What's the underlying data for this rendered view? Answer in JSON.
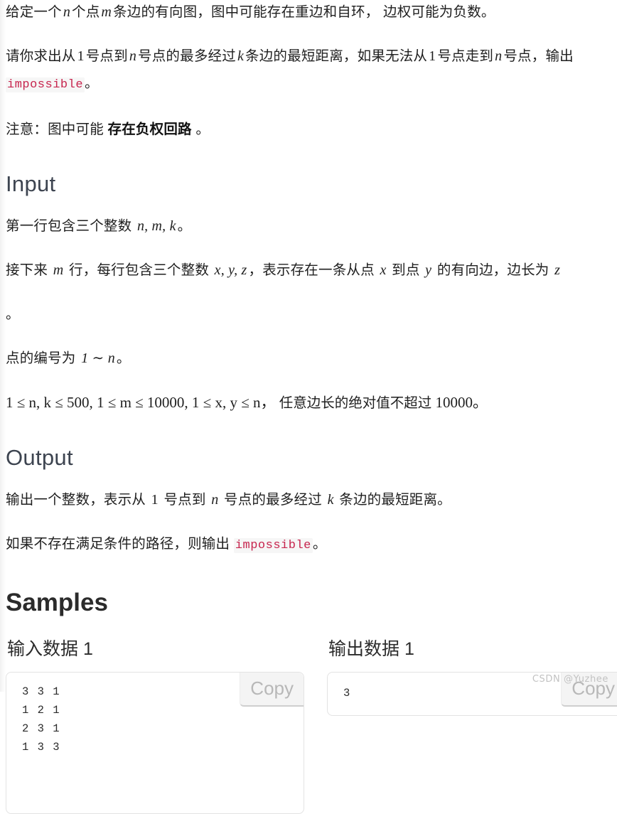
{
  "problem": {
    "p1_pre": "给定一个",
    "p1_n": "n",
    "p1_mid1": "个点",
    "p1_m": "m",
    "p1_mid2": "条边的有向图，图中可能存在重边和自环，  边权可能为负数。",
    "p2_pre": "请你求出从",
    "p2_one": "1",
    "p2_a": "号点到",
    "p2_n": "n",
    "p2_b": "号点的最多经过",
    "p2_k": "k",
    "p2_c": "条边的最短距离，如果无法从",
    "p2_one2": "1",
    "p2_d": "号点走到",
    "p2_n2": "n",
    "p2_e": "号点，输出",
    "p2_code": "impossible",
    "p2_end": "。",
    "p3_pre": "注意：图中可能",
    "p3_bold": "存在负权回路",
    "p3_end": "。"
  },
  "input_section": {
    "heading": "Input",
    "line1_pre": "第一行包含三个整数",
    "line1_vars": "n, m, k",
    "line1_end": "。",
    "line2_pre": "接下来",
    "line2_m": "m",
    "line2_a": "行，每行包含三个整数",
    "line2_vars": "x, y, z",
    "line2_b": "，表示存在一条从点",
    "line2_x": "x",
    "line2_c": "到点",
    "line2_y": "y",
    "line2_d": "的有向边，边长为",
    "line2_z": "z",
    "line2_end": "。",
    "line3_pre": "点的编号为",
    "line3_range": "1 ∼ n",
    "line3_end": "。",
    "constraint_a": "1 ≤ n, k ≤ 500, 1 ≤ m ≤ 10000, 1 ≤ x, y ≤ n，",
    "constraint_cjk": "任意边长的绝对值不超过",
    "constraint_b": "10000。"
  },
  "output_section": {
    "heading": "Output",
    "line1_pre": "输出一个整数，表示从",
    "line1_one": "1",
    "line1_a": "号点到",
    "line1_n": "n",
    "line1_b": "号点的最多经过",
    "line1_k": "k",
    "line1_c": "条边的最短距离。",
    "line2_pre": "如果不存在满足条件的路径，则输出",
    "line2_code": "impossible",
    "line2_end": "。"
  },
  "samples": {
    "title": "Samples",
    "input_label": "输入数据 1",
    "output_label": "输出数据 1",
    "copy_label": "Copy",
    "input_content": "3 3 1\n1 2 1\n2 3 1\n1 3 3",
    "output_content": "3"
  },
  "watermark": {
    "text": "CSDN @Yuzhee"
  },
  "colors": {
    "code_red": "#c7254e",
    "heading_slate": "#3d4450",
    "body_text": "#1f1f1f",
    "box_border": "#e3e3e3",
    "copy_bg": "#f4f4f4",
    "watermark": "#c2c2c2"
  }
}
